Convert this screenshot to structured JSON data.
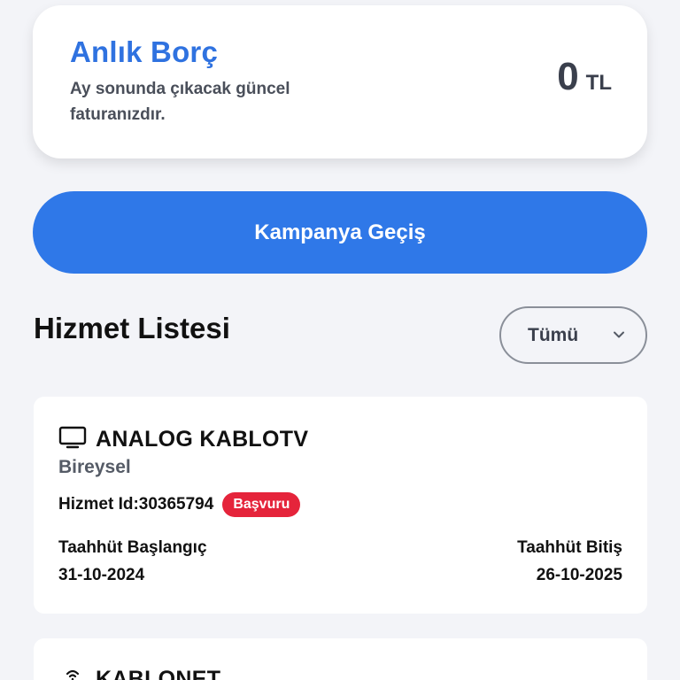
{
  "debt_card": {
    "title": "Anlık Borç",
    "description": "Ay sonunda çıkacak güncel faturanızdır.",
    "amount": "0",
    "currency": "TL"
  },
  "campaign_button": {
    "label": "Kampanya Geçiş"
  },
  "service_list": {
    "title": "Hizmet Listesi",
    "filter": {
      "selected": "Tümü"
    },
    "items": [
      {
        "icon": "tv-icon",
        "name": "ANALOG KABLOTV",
        "type": "Bireysel",
        "service_id": "Hizmet Id:30365794",
        "status_badge": "Başvuru",
        "commitment_start_label": "Taahhüt Başlangıç",
        "commitment_start": "31-10-2024",
        "commitment_end_label": "Taahhüt Bitiş",
        "commitment_end": "26-10-2025"
      },
      {
        "icon": "wifi-icon",
        "name": "KABLONET"
      }
    ]
  },
  "colors": {
    "accent": "#2f78e8",
    "title_blue": "#2f72e0",
    "badge_red": "#e5243b",
    "background": "#f3f4f8"
  }
}
